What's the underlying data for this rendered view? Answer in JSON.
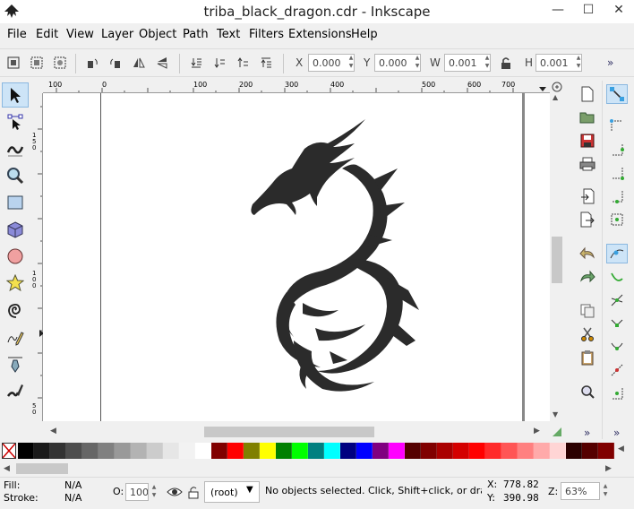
{
  "window": {
    "title": "triba_black_dragon.cdr - Inkscape",
    "minimize": "—",
    "maximize": "☐",
    "close": "✕"
  },
  "menu": [
    "File",
    "Edit",
    "View",
    "Layer",
    "Object",
    "Path",
    "Text",
    "Filters",
    "Extensions",
    "Help"
  ],
  "controls": {
    "x_label": "X",
    "x_value": "0.000",
    "y_label": "Y",
    "y_value": "0.000",
    "w_label": "W",
    "w_value": "0.001",
    "h_label": "H",
    "h_value": "0.001",
    "overflow": "»"
  },
  "ruler": {
    "h_labels": [
      "100",
      "0",
      "100",
      "200",
      "300",
      "400",
      "500",
      "600",
      "700"
    ],
    "v_labels": [
      "150",
      "100",
      "50"
    ]
  },
  "colors": {
    "accent": "#cde4f7",
    "dragon": "#2b2b2b",
    "palette": [
      "#000000",
      "#1a1a1a",
      "#333333",
      "#4d4d4d",
      "#666666",
      "#808080",
      "#999999",
      "#b3b3b3",
      "#cccccc",
      "#e6e6e6",
      "#f2f2f2",
      "#ffffff",
      "#800000",
      "#ff0000",
      "#808000",
      "#ffff00",
      "#008000",
      "#00ff00",
      "#008080",
      "#00ffff",
      "#000080",
      "#0000ff",
      "#800080",
      "#ff00ff",
      "#550000",
      "#800000",
      "#aa0000",
      "#d40000",
      "#ff0000",
      "#ff2a2a",
      "#ff5555",
      "#ff8080",
      "#ffaaaa",
      "#ffd5d5",
      "#2b0000",
      "#550000",
      "#800000"
    ]
  },
  "status": {
    "fill_label": "Fill:",
    "fill_value": "N/A",
    "stroke_label": "Stroke:",
    "stroke_value": "N/A",
    "opacity_label": "O:",
    "opacity_value": "100",
    "layer": "(root)",
    "message": "No objects selected. Click, Shift+click, or drag",
    "x_label": "X:",
    "x_coord": "778.82",
    "y_label": "Y:",
    "y_coord": "390.98",
    "zoom_label": "Z:",
    "zoom": "63%"
  }
}
